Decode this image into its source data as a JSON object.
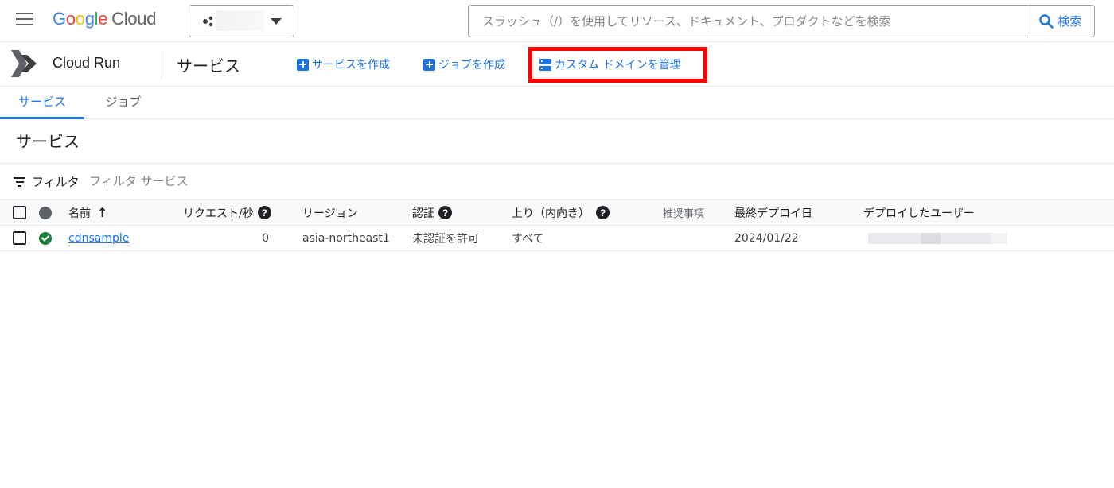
{
  "topbar": {
    "logo": {
      "g1": "G",
      "g2": "o",
      "g3": "o",
      "g4": "g",
      "g5": "l",
      "g6": "e",
      "cloud": "Cloud"
    },
    "search_placeholder": "スラッシュ（/）を使用してリソース、ドキュメント、プロダクトなどを検索",
    "search_button": "検索"
  },
  "productbar": {
    "product_name": "Cloud Run",
    "page_title": "サービス",
    "actions": {
      "create_service": "サービスを作成",
      "create_job": "ジョブを作成",
      "manage_domains": "カスタム ドメインを管理"
    }
  },
  "tabs": [
    {
      "label": "サービス",
      "active": true
    },
    {
      "label": "ジョブ",
      "active": false
    }
  ],
  "section_title": "サービス",
  "filter": {
    "label": "フィルタ",
    "placeholder": "フィルタ サービス"
  },
  "table": {
    "headers": {
      "name": "名前",
      "requests": "リクエスト/秒",
      "region": "リージョン",
      "auth": "認証",
      "ingress": "上り（内向き）",
      "recommendations": "推奨事項",
      "last_deployed": "最終デプロイ日",
      "deployed_by": "デプロイしたユーザー"
    },
    "rows": [
      {
        "name": "cdnsample",
        "requests": "0",
        "region": "asia-northeast1",
        "auth": "未認証を許可",
        "ingress": "すべて",
        "recommendations": "",
        "last_deployed": "2024/01/22"
      }
    ]
  },
  "colors": {
    "accent": "#1a73e8",
    "highlight": "#ff0000",
    "status_ok": "#188038"
  }
}
